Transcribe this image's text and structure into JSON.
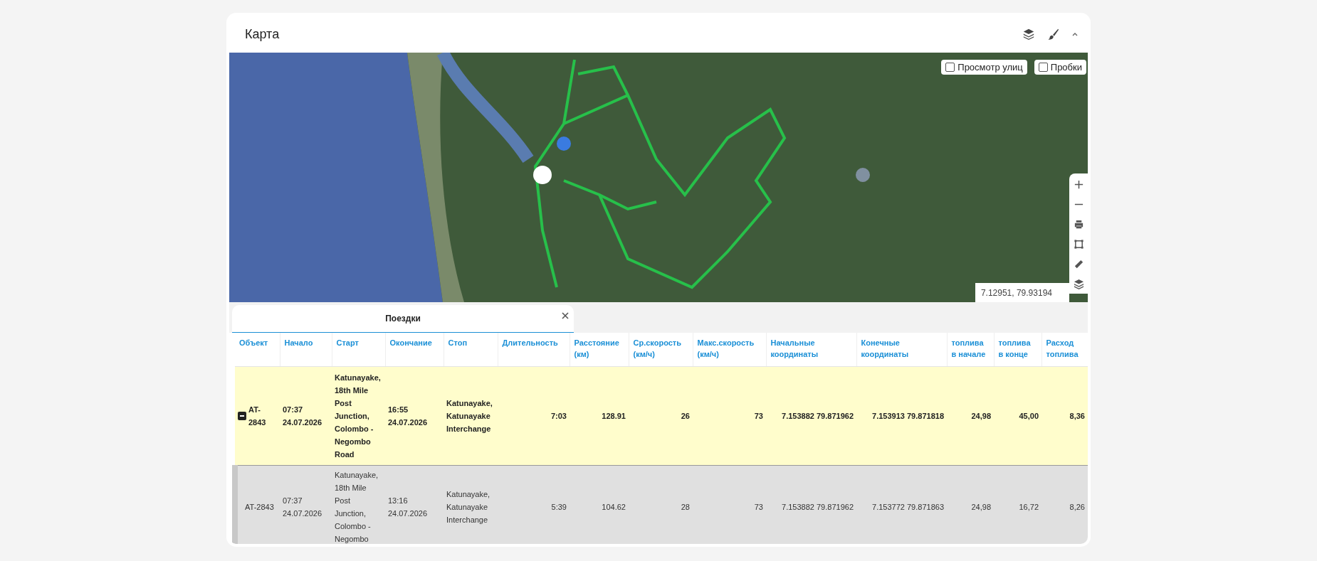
{
  "header": {
    "title": "Карта"
  },
  "map": {
    "overlays": [
      {
        "label": "Просмотр улиц",
        "checked": false
      },
      {
        "label": "Пробки",
        "checked": false
      }
    ],
    "coordinates": "7.12951, 79.93194"
  },
  "trips_panel": {
    "title": "Поездки"
  },
  "table": {
    "columns": [
      "Объект",
      "Начало",
      "Старт",
      "Окончание",
      "Стоп",
      "Длительность",
      "Расстояние (км)",
      "Ср.скорость (км/ч)",
      "Макс.скорость (км/ч)",
      "Начальные координаты",
      "Конечные координаты",
      "топлива в начале",
      "топлива в конце",
      "Расход топлива"
    ],
    "rows": [
      {
        "selected": true,
        "expanded": true,
        "cells": [
          "AT-2843",
          "07:37 24.07.2026",
          "Katunayake, 18th Mile Post Junction, Colombo - Negombo Road",
          "16:55 24.07.2026",
          "Katunayake, Katunayake Interchange",
          "7:03",
          "128.91",
          "26",
          "73",
          "7.153882 79.871962",
          "7.153913 79.871818",
          "24,98",
          "45,00",
          "8,36"
        ],
        "children": [
          {
            "selected": false,
            "cells": [
              "AT-2843",
              "07:37 24.07.2026",
              "Katunayake, 18th Mile Post Junction, Colombo - Negombo",
              "13:16 24.07.2026",
              "Katunayake, Katunayake Interchange",
              "5:39",
              "104.62",
              "28",
              "73",
              "7.153882 79.871962",
              "7.153772 79.871863",
              "24,98",
              "16,72",
              "8,26"
            ]
          }
        ]
      }
    ]
  }
}
